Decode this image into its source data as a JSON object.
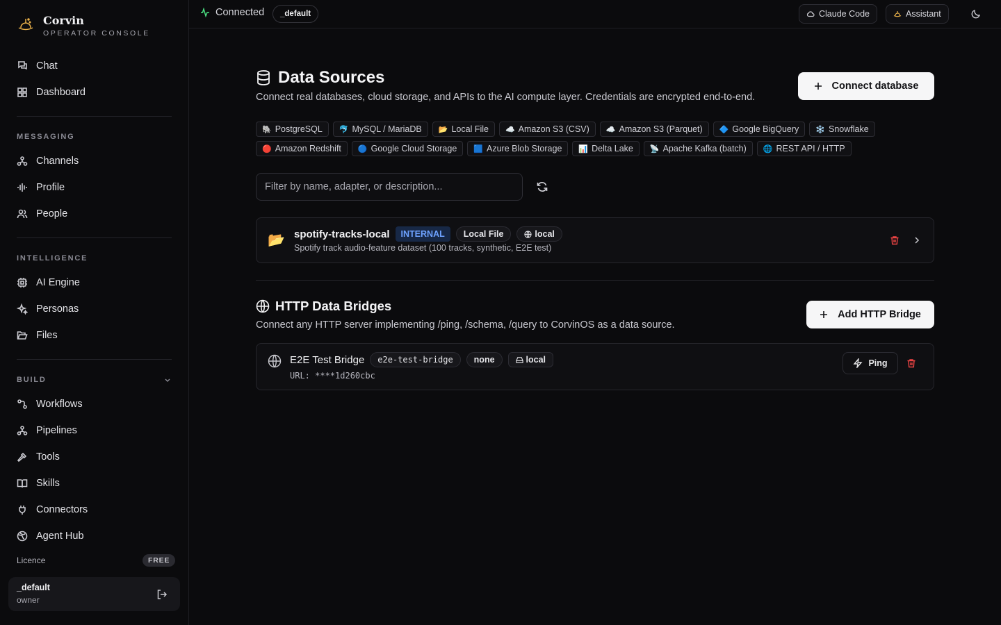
{
  "brand": {
    "name": "Corvin",
    "subtitle": "OPERATOR CONSOLE"
  },
  "sidebar": {
    "top_items": [
      {
        "label": "Chat",
        "icon": "chat-icon"
      },
      {
        "label": "Dashboard",
        "icon": "dashboard-icon"
      }
    ],
    "sections": [
      {
        "label": "MESSAGING",
        "items": [
          {
            "label": "Channels",
            "icon": "channels-icon"
          },
          {
            "label": "Profile",
            "icon": "waveform-icon"
          },
          {
            "label": "People",
            "icon": "people-icon"
          }
        ]
      },
      {
        "label": "INTELLIGENCE",
        "items": [
          {
            "label": "AI Engine",
            "icon": "cpu-icon"
          },
          {
            "label": "Personas",
            "icon": "sparkles-icon"
          },
          {
            "label": "Files",
            "icon": "folder-icon"
          }
        ]
      },
      {
        "label": "BUILD",
        "items": [
          {
            "label": "Workflows",
            "icon": "workflow-icon"
          },
          {
            "label": "Pipelines",
            "icon": "pipeline-icon"
          },
          {
            "label": "Tools",
            "icon": "hammer-icon"
          },
          {
            "label": "Skills",
            "icon": "book-icon"
          },
          {
            "label": "Connectors",
            "icon": "plug-icon"
          },
          {
            "label": "Agent Hub",
            "icon": "globe-icon"
          }
        ]
      }
    ],
    "licence_label": "Licence",
    "licence_badge": "FREE",
    "user": {
      "name": "_default",
      "role": "owner"
    }
  },
  "topbar": {
    "status": "Connected",
    "workspace": "_default",
    "claude_code_label": "Claude Code",
    "assistant_label": "Assistant"
  },
  "data_sources": {
    "title": "Data Sources",
    "description": "Connect real databases, cloud storage, and APIs to the AI compute layer. Credentials are encrypted end-to-end.",
    "connect_button": "Connect database",
    "adapters": [
      {
        "emoji": "🐘",
        "label": "PostgreSQL"
      },
      {
        "emoji": "🐬",
        "label": "MySQL / MariaDB"
      },
      {
        "emoji": "📂",
        "label": "Local File"
      },
      {
        "emoji": "☁️",
        "label": "Amazon S3 (CSV)"
      },
      {
        "emoji": "☁️",
        "label": "Amazon S3 (Parquet)"
      },
      {
        "emoji": "🔷",
        "label": "Google BigQuery"
      },
      {
        "emoji": "❄️",
        "label": "Snowflake"
      },
      {
        "emoji": "🔴",
        "label": "Amazon Redshift"
      },
      {
        "emoji": "🔵",
        "label": "Google Cloud Storage"
      },
      {
        "emoji": "🟦",
        "label": "Azure Blob Storage"
      },
      {
        "emoji": "📊",
        "label": "Delta Lake"
      },
      {
        "emoji": "📡",
        "label": "Apache Kafka (batch)"
      },
      {
        "emoji": "🌐",
        "label": "REST API / HTTP"
      }
    ],
    "filter_placeholder": "Filter by name, adapter, or description...",
    "sources": [
      {
        "icon": "📂",
        "name": "spotify-tracks-local",
        "visibility": "INTERNAL",
        "adapter": "Local File",
        "scope": "local",
        "description": "Spotify track audio-feature dataset (100 tracks, synthetic, E2E test)"
      }
    ]
  },
  "bridges": {
    "title": "HTTP Data Bridges",
    "description": "Connect any HTTP server implementing /ping, /schema, /query to CorvinOS as a data source.",
    "add_button": "Add HTTP Bridge",
    "items": [
      {
        "name": "E2E Test Bridge",
        "id": "e2e-test-bridge",
        "auth": "none",
        "scope": "local",
        "url": "URL: ****1d260cbc",
        "ping_label": "Ping"
      }
    ]
  },
  "colors": {
    "accent_green": "#4ade80",
    "danger": "#ef4444",
    "internal_badge": "#6ea2ff"
  }
}
